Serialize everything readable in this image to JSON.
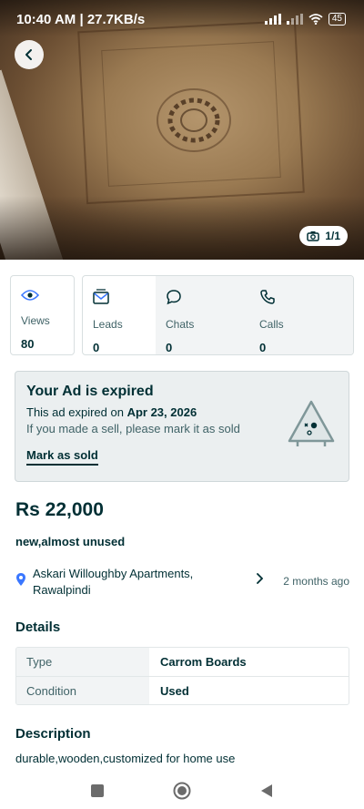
{
  "status_bar": {
    "time": "10:40 AM | 27.7KB/s",
    "battery": "45"
  },
  "photo": {
    "counter": "1/1"
  },
  "stats": {
    "views": {
      "label": "Views",
      "value": "80"
    },
    "leads": {
      "label": "Leads",
      "value": "0"
    },
    "chats": {
      "label": "Chats",
      "value": "0"
    },
    "calls": {
      "label": "Calls",
      "value": "0"
    }
  },
  "expired": {
    "title": "Your Ad is expired",
    "line1_prefix": "This ad expired on ",
    "expiry_date": "Apr 23, 2026",
    "line2": "If you made a sell, please mark it as sold",
    "action": "Mark as sold"
  },
  "ad": {
    "price": "Rs 22,000",
    "title": "new,almost unused",
    "location_line1": "Askari Willoughby Apartments,",
    "location_line2": "Rawalpindi",
    "posted": "2 months ago"
  },
  "details": {
    "heading": "Details",
    "rows": [
      {
        "key": "Type",
        "value": "Carrom Boards"
      },
      {
        "key": "Condition",
        "value": "Used"
      }
    ]
  },
  "description": {
    "heading": "Description",
    "text": "durable,wooden,customized for home use"
  },
  "colors": {
    "primary_text": "#002f34",
    "secondary_text": "#406367",
    "accent_blue": "#3a77ff"
  },
  "icons": {
    "back": "arrow-left-icon",
    "camera": "camera-icon",
    "views": "eye-icon",
    "leads": "mail-icon",
    "chats": "chat-bubble-icon",
    "calls": "phone-icon",
    "location": "location-pin-icon",
    "chevron": "chevron-right-icon"
  }
}
